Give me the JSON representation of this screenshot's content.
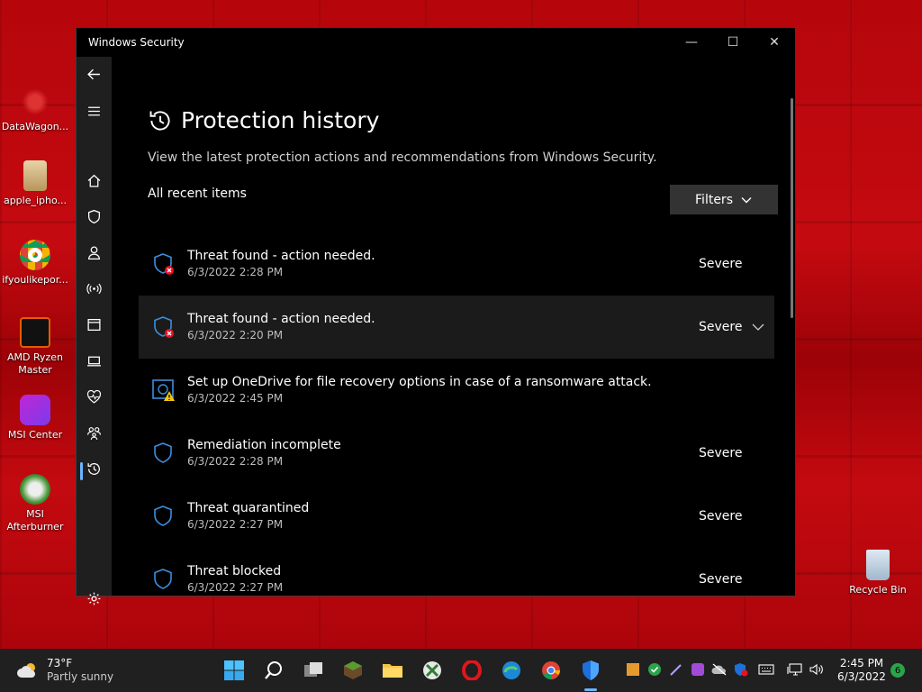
{
  "desktop": {
    "icons": [
      {
        "label": "DataWagon...",
        "icon": "datawagon-icon"
      },
      {
        "label": "apple_ipho...",
        "icon": "file-image-icon"
      },
      {
        "label": "ifyoulikepor...",
        "icon": "chrome-icon"
      },
      {
        "label": "AMD Ryzen Master",
        "icon": "ryzen-icon"
      },
      {
        "label": "MSI Center",
        "icon": "msi-center-icon"
      },
      {
        "label": "MSI Afterburner",
        "icon": "msi-afterburner-icon"
      },
      {
        "label": "Recycle Bin",
        "icon": "recycle-bin-icon"
      }
    ]
  },
  "window": {
    "title": "Windows Security",
    "controls": {
      "minimize": "—",
      "maximize": "☐",
      "close": "✕"
    }
  },
  "page": {
    "title": "Protection history",
    "description": "View the latest protection actions and recommendations from Windows Security.",
    "section_label": "All recent items",
    "filters_label": "Filters"
  },
  "items": [
    {
      "title": "Threat found - action needed.",
      "time": "6/3/2022 2:28 PM",
      "severity": "Severe",
      "icon": "shield-x-icon"
    },
    {
      "title": "Threat found - action needed.",
      "time": "6/3/2022 2:20 PM",
      "severity": "Severe",
      "icon": "shield-x-icon"
    },
    {
      "title": "Set up OneDrive for file recovery options in case of a ransomware attack.",
      "time": "6/3/2022 2:45 PM",
      "severity": "",
      "icon": "onedrive-warning-icon"
    },
    {
      "title": "Remediation incomplete",
      "time": "6/3/2022 2:28 PM",
      "severity": "Severe",
      "icon": "shield-icon"
    },
    {
      "title": "Threat quarantined",
      "time": "6/3/2022 2:27 PM",
      "severity": "Severe",
      "icon": "shield-icon"
    },
    {
      "title": "Threat blocked",
      "time": "6/3/2022 2:27 PM",
      "severity": "Severe",
      "icon": "shield-icon"
    }
  ],
  "taskbar": {
    "weather_temp": "73°F",
    "weather_desc": "Partly sunny",
    "time": "2:45 PM",
    "date": "6/3/2022",
    "notifications": "6"
  },
  "colors": {
    "accent": "#6ab4ff",
    "shield": "#3b8fe0",
    "danger": "#e81123",
    "warning": "#f2c811"
  }
}
